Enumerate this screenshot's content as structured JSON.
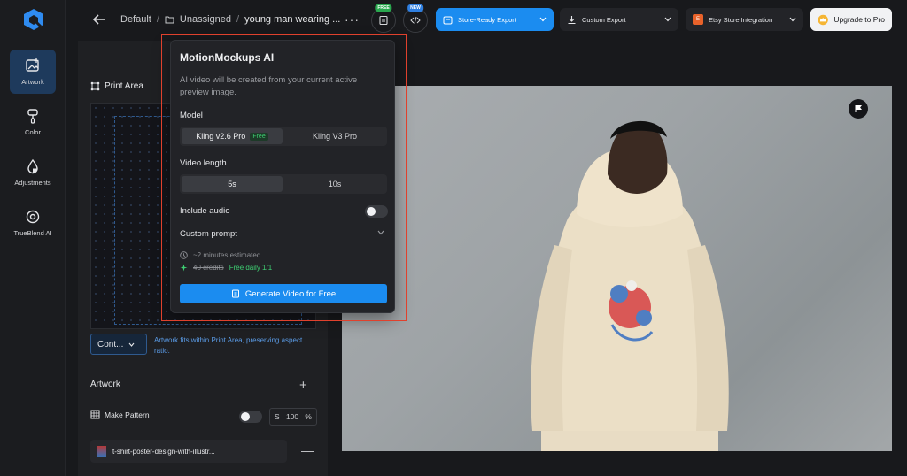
{
  "rail": {
    "items": [
      {
        "label": "Artwork",
        "icon": "artwork-icon",
        "active": true
      },
      {
        "label": "Color",
        "icon": "brush-icon",
        "active": false
      },
      {
        "label": "Adjustments",
        "icon": "droplet-icon",
        "active": false
      },
      {
        "label": "TrueBlend AI",
        "icon": "gear-icon",
        "active": false
      }
    ]
  },
  "topbar": {
    "breadcrumb": [
      "Default",
      "Unassigned",
      "young man wearing ..."
    ],
    "more": "···",
    "badge_free": "FREE",
    "badge_new": "NEW",
    "store_export": "Store-Ready Export",
    "custom_export": "Custom Export",
    "etsy": "Etsy Store Integration",
    "upgrade": "Upgrade to Pro"
  },
  "panel": {
    "print_area_title": "Print Area",
    "fit_select": "Cont...",
    "fit_text": "Artwork fits within Print Area, preserving aspect ratio.",
    "artwork_title": "Artwork",
    "make_pattern": "Make Pattern",
    "scale_prefix": "S",
    "scale_value": "100",
    "scale_unit": "%",
    "artwork_item": "t-shirt-poster-design-with-illustr..."
  },
  "popup": {
    "title": "MotionMockups AI",
    "description": "AI video will be created from your current active preview image.",
    "model_label": "Model",
    "models": [
      {
        "label": "Kling v2.6 Pro",
        "badge": "Free",
        "selected": true
      },
      {
        "label": "Kling V3 Pro",
        "badge": "",
        "selected": false
      }
    ],
    "length_label": "Video length",
    "lengths": [
      {
        "label": "5s",
        "selected": true
      },
      {
        "label": "10s",
        "selected": false
      }
    ],
    "audio_label": "Include audio",
    "audio_on": false,
    "prompt_label": "Custom prompt",
    "estimate": "~2 minutes estimated",
    "credits_old": "40 credits",
    "credits_free": "Free daily 1/1",
    "generate": "Generate Video for Free"
  },
  "colors": {
    "accent": "#1b8cf0",
    "highlight": "#e0412d",
    "free_green": "#3ecf72"
  }
}
